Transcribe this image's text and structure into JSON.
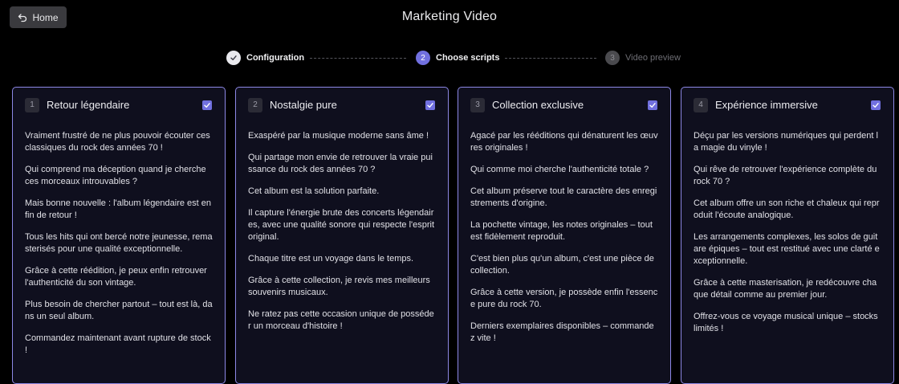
{
  "header": {
    "home_label": "Home",
    "title": "Marketing Video"
  },
  "stepper": [
    {
      "label": "Configuration",
      "state": "done",
      "number": ""
    },
    {
      "label": "Choose scripts",
      "state": "active",
      "number": "2"
    },
    {
      "label": "Video preview",
      "state": "pending",
      "number": "3"
    }
  ],
  "colors": {
    "accent": "#7170e0",
    "card_border": "#8d88e6",
    "card_bg": "#0f0f1e",
    "background": "#000000"
  },
  "cards": [
    {
      "number": "1",
      "title": "Retour légendaire",
      "checked": true,
      "lines": [
        "Vraiment frustré de ne plus pouvoir écouter ces classiques du rock des années 70 !",
        "Qui comprend ma déception quand je cherche ces morceaux introuvables ?",
        "Mais bonne nouvelle : l'album légendaire est enfin de retour !",
        "Tous les hits qui ont bercé notre jeunesse, remasterisés pour une qualité exceptionnelle.",
        "Grâce à cette réédition, je peux enfin retrouver l'authenticité du son vintage.",
        "Plus besoin de chercher partout – tout est là, dans un seul album.",
        "Commandez maintenant avant rupture de stock !"
      ]
    },
    {
      "number": "2",
      "title": "Nostalgie pure",
      "checked": true,
      "lines": [
        "Exaspéré par la musique moderne sans âme !",
        "Qui partage mon envie de retrouver la vraie puissance du rock des années 70 ?",
        "Cet album est la solution parfaite.",
        "Il capture l'énergie brute des concerts légendaires, avec une qualité sonore qui respecte l'esprit original.",
        "Chaque titre est un voyage dans le temps.",
        "Grâce à cette collection, je revis mes meilleurs souvenirs musicaux.",
        "Ne ratez pas cette occasion unique de posséder un morceau d'histoire !"
      ]
    },
    {
      "number": "3",
      "title": "Collection exclusive",
      "checked": true,
      "lines": [
        "Agacé par les rééditions qui dénaturent les œuvres originales !",
        "Qui comme moi cherche l'authenticité totale ?",
        "Cet album préserve tout le caractère des enregistrements d'origine.",
        "La pochette vintage, les notes originales – tout est fidèlement reproduit.",
        "C'est bien plus qu'un album, c'est une pièce de collection.",
        "Grâce à cette version, je possède enfin l'essence pure du rock 70.",
        "Derniers exemplaires disponibles – commandez vite !"
      ]
    },
    {
      "number": "4",
      "title": "Expérience immersive",
      "checked": true,
      "lines": [
        "Déçu par les versions numériques qui perdent la magie du vinyle !",
        "Qui rêve de retrouver l'expérience complète du rock 70 ?",
        "Cet album offre un son riche et chaleux qui reproduit l'écoute analogique.",
        "Les arrangements complexes, les solos de guitare épiques – tout est restitué avec une clarté exceptionnelle.",
        "Grâce à cette masterisation, je redécouvre chaque détail comme au premier jour.",
        "Offrez-vous ce voyage musical unique – stocks limités !"
      ]
    }
  ]
}
